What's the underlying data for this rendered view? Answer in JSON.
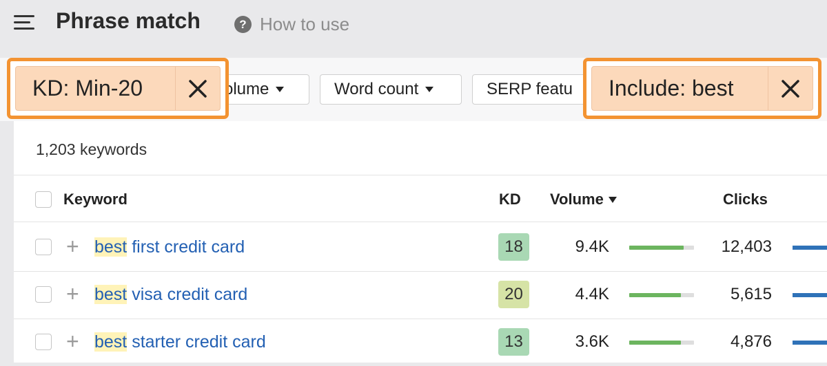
{
  "header": {
    "title": "Phrase match",
    "help_label": "How to use",
    "help_icon": "?"
  },
  "filters": {
    "kd_chip": {
      "label": "KD: Min-20",
      "close_icon": "close-icon"
    },
    "volume": {
      "label": "olume"
    },
    "word_count": {
      "label": "Word count"
    },
    "serp": {
      "label": "SERP featu"
    },
    "include_chip": {
      "label": "Include: best",
      "close_icon": "close-icon"
    }
  },
  "results": {
    "count_label": "1,203 keywords"
  },
  "table": {
    "headers": {
      "keyword": "Keyword",
      "kd": "KD",
      "volume": "Volume",
      "clicks": "Clicks"
    },
    "rows": [
      {
        "highlight": "best",
        "rest": " first credit card",
        "kd": "18",
        "kd_color": "#a9d8b4",
        "volume": "9.4K",
        "volume_bar": 0.84,
        "clicks": "12,403"
      },
      {
        "highlight": "best",
        "rest": " visa credit card",
        "kd": "20",
        "kd_color": "#d6e3a6",
        "volume": "4.4K",
        "volume_bar": 0.8,
        "clicks": "5,615"
      },
      {
        "highlight": "best",
        "rest": " starter credit card",
        "kd": "13",
        "kd_color": "#a9d8b4",
        "volume": "3.6K",
        "volume_bar": 0.8,
        "clicks": "4,876"
      }
    ]
  },
  "colors": {
    "highlight_outline": "#f39332",
    "chip_fill": "#fcd9bb",
    "link": "#2360b3",
    "volume_bar": "#6cb55f",
    "clicks_bar": "#2f72b8"
  }
}
